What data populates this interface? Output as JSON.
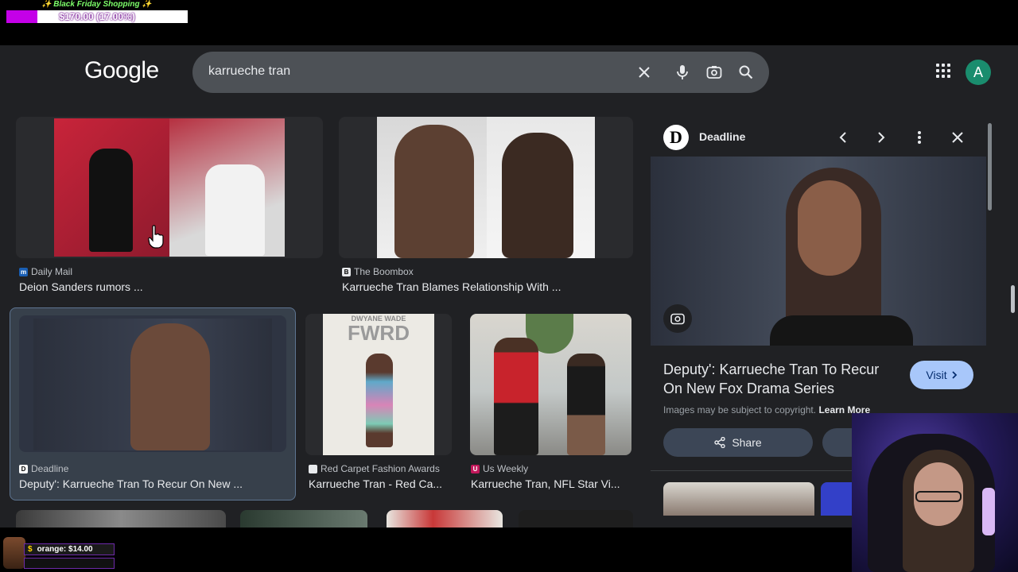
{
  "stream": {
    "goal_title": "✨ Black Friday Shopping ✨",
    "goal_amount": "$170.00 (17.00%)",
    "goal_progress": 0.17,
    "chat_message": "orange: $14.00",
    "chat_currency": "$"
  },
  "header": {
    "logo": "Google",
    "search_query": "karrueche tran",
    "avatar_letter": "A"
  },
  "results": [
    {
      "source": "Daily Mail",
      "favicon": "m",
      "title": "Deion Sanders rumors ..."
    },
    {
      "source": "The Boombox",
      "favicon": "B",
      "title": "Karrueche Tran Blames Relationship With ..."
    },
    {
      "source": "Deadline",
      "favicon": "D",
      "title": "Deputy': Karrueche Tran To Recur On New ..."
    },
    {
      "source": "Red Carpet Fashion Awards",
      "favicon": "",
      "title": "Karrueche Tran - Red Ca..."
    },
    {
      "source": "Us Weekly",
      "favicon": "U",
      "title": "Karrueche Tran, NFL Star Vi..."
    }
  ],
  "image_texts": {
    "fwrd_top": "DWYANE WADE",
    "fwrd": "FWRD"
  },
  "panel": {
    "source": "Deadline",
    "logo_letter": "D",
    "title": "Deputy': Karrueche Tran To Recur On New Fox Drama Series",
    "visit_label": "Visit",
    "copyright": "Images may be subject to copyright.",
    "learn_more": "Learn More",
    "share_label": "Share"
  },
  "colors": {
    "page_bg": "#202124",
    "search_bg": "#4d5156",
    "visit_bg": "#a8c7fa",
    "avatar_bg": "#1a8d6e",
    "goal_fill": "#c400e8"
  }
}
